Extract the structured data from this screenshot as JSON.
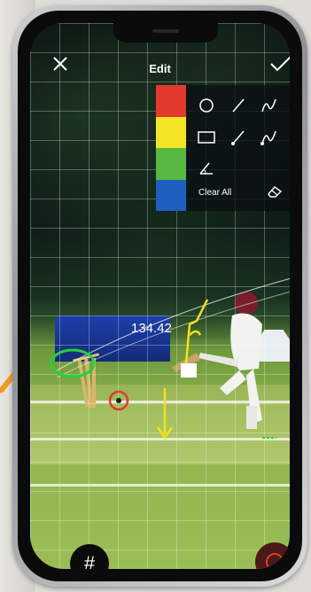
{
  "header": {
    "title": "Edit",
    "close_icon": "close-icon",
    "confirm_icon": "checkmark-icon"
  },
  "palette": {
    "colors": [
      "#e23a2d",
      "#f3e526",
      "#57b940",
      "#1f5fbf"
    ]
  },
  "tools": {
    "circle": "circle-icon",
    "line": "line-icon",
    "freehand": "freehand-icon",
    "rectangle": "rectangle-icon",
    "line_arrow": "line-arrow-icon",
    "freehand_arrow": "freehand-arrow-icon",
    "angle": "angle-icon",
    "clear_all_label": "Clear All",
    "eraser": "eraser-icon"
  },
  "overlay": {
    "speed_label": "134.42",
    "annotation_colors": {
      "green": "#27d13b",
      "yellow": "#f2e21c",
      "red": "#e23a2d"
    }
  },
  "bottom": {
    "grid_button_icon": "grid-icon",
    "record_button_icon": "record-icon"
  }
}
